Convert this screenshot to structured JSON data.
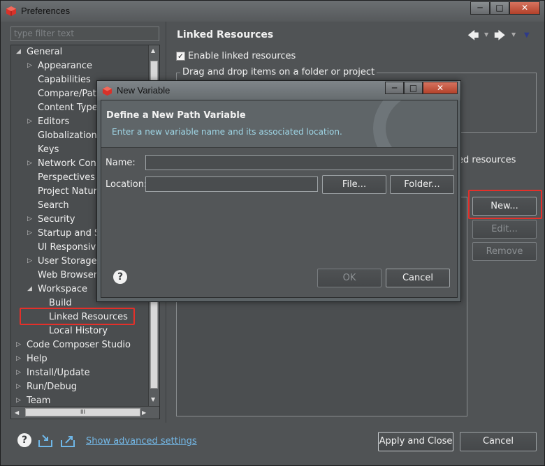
{
  "window": {
    "title": "Preferences",
    "controls": [
      "minimize",
      "maximize",
      "close"
    ]
  },
  "filter": {
    "placeholder": "type filter text"
  },
  "tree": {
    "items": [
      {
        "label": "General",
        "expanded": true,
        "level": 0
      },
      {
        "label": "Appearance",
        "expandable": true,
        "level": 1
      },
      {
        "label": "Capabilities",
        "level": 1
      },
      {
        "label": "Compare/Patc",
        "level": 1
      },
      {
        "label": "Content Types",
        "level": 1
      },
      {
        "label": "Editors",
        "expandable": true,
        "level": 1
      },
      {
        "label": "Globalization",
        "level": 1
      },
      {
        "label": "Keys",
        "level": 1
      },
      {
        "label": "Network Conn",
        "expandable": true,
        "level": 1
      },
      {
        "label": "Perspectives",
        "level": 1
      },
      {
        "label": "Project Nature",
        "level": 1
      },
      {
        "label": "Search",
        "level": 1
      },
      {
        "label": "Security",
        "expandable": true,
        "level": 1
      },
      {
        "label": "Startup and Sh",
        "expandable": true,
        "level": 1
      },
      {
        "label": "UI Responsive",
        "level": 1
      },
      {
        "label": "User Storage S",
        "expandable": true,
        "level": 1
      },
      {
        "label": "Web Browser",
        "level": 1
      },
      {
        "label": "Workspace",
        "expanded": true,
        "level": 1
      },
      {
        "label": "Build",
        "level": 2
      },
      {
        "label": "Linked Resources",
        "level": 2,
        "selected": true
      },
      {
        "label": "Local History",
        "level": 2
      },
      {
        "label": "Code Composer Studio",
        "expandable": true,
        "level": 0
      },
      {
        "label": "Help",
        "expandable": true,
        "level": 0
      },
      {
        "label": "Install/Update",
        "expandable": true,
        "level": 0
      },
      {
        "label": "Run/Debug",
        "expandable": true,
        "level": 0
      },
      {
        "label": "Team",
        "expandable": true,
        "level": 0
      }
    ],
    "hscroll_grip": "III"
  },
  "page": {
    "title": "Linked Resources",
    "enable_label": "Enable linked resources",
    "enable_checked": true,
    "drag_group_label": "Drag and drop items on a folder or project",
    "fragment_right": "ed resources",
    "buttons": {
      "new": "New...",
      "edit": "Edit...",
      "remove": "Remove"
    }
  },
  "footer": {
    "advanced_link": "Show advanced settings",
    "apply_close": "Apply and Close",
    "cancel": "Cancel"
  },
  "dialog": {
    "title": "New Variable",
    "heading": "Define a New Path Variable",
    "message": "Enter a new variable name and its associated location.",
    "name_label": "Name:",
    "name_value": "",
    "location_label": "Location:",
    "location_value": "",
    "file_button": "File...",
    "folder_button": "Folder...",
    "ok": "OK",
    "cancel": "Cancel"
  },
  "colors": {
    "highlight_box": "#e4302a",
    "message_text": "#9fd6e6",
    "link": "#74b9e8"
  }
}
